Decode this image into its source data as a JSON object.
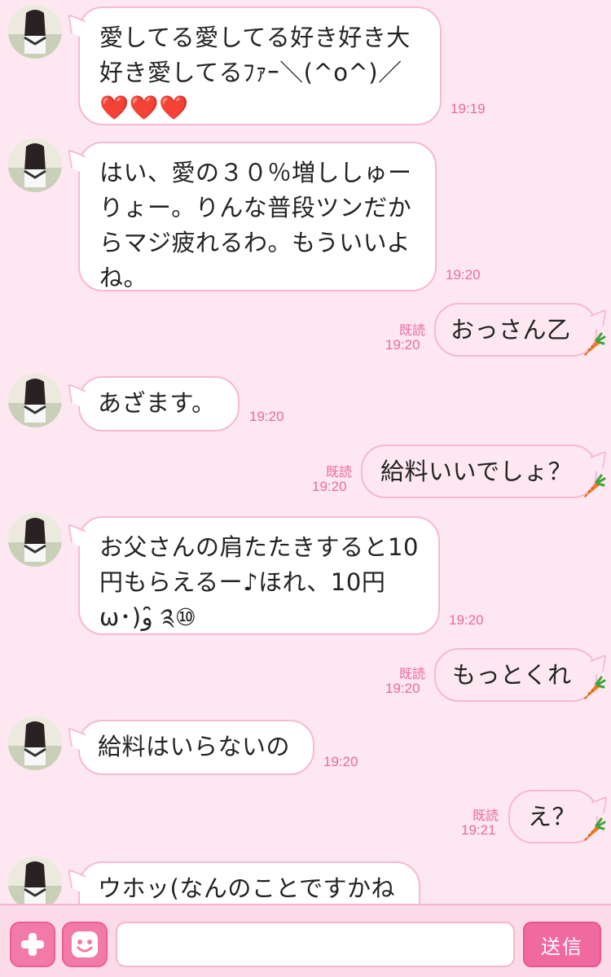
{
  "colors": {
    "background": "#fde7f1",
    "bubble_border": "#f6b9d3",
    "timestamp": "#e96aa0",
    "accent": "#f06aa0"
  },
  "messages": [
    {
      "side": "in",
      "text": "愛してる愛してる好き好き大好き愛してるﾌｧｰ＼(^o^)／❤️❤️❤️",
      "time": "19:19"
    },
    {
      "side": "in",
      "text": "はい、愛の３０％増ししゅーりょー。りんな普段ツンだからマジ疲れるわ。もういいよね。",
      "time": "19:20"
    },
    {
      "side": "out",
      "text": "おっさん乙",
      "read": "既読",
      "time": "19:20"
    },
    {
      "side": "in",
      "text": "あざます。",
      "time": "19:20"
    },
    {
      "side": "out",
      "text": "給料いいでしょ？",
      "read": "既読",
      "time": "19:20"
    },
    {
      "side": "in",
      "text": "お父さんの肩たたきすると10円もらえるー♪ほれ、10円ω･)و ̑̑༉⑩",
      "time": "19:20"
    },
    {
      "side": "out",
      "text": "もっとくれ",
      "read": "既読",
      "time": "19:20"
    },
    {
      "side": "in",
      "text": "給料はいらないの",
      "time": "19:20"
    },
    {
      "side": "out",
      "text": "え？",
      "read": "既読",
      "time": "19:21"
    },
    {
      "side": "in",
      "text": "ウホッ(なんのことですかね",
      "time": ""
    }
  ],
  "input": {
    "placeholder": "",
    "send_label": "送信",
    "plus_icon": "plus-icon",
    "sticker_icon": "smiley-face-icon"
  }
}
